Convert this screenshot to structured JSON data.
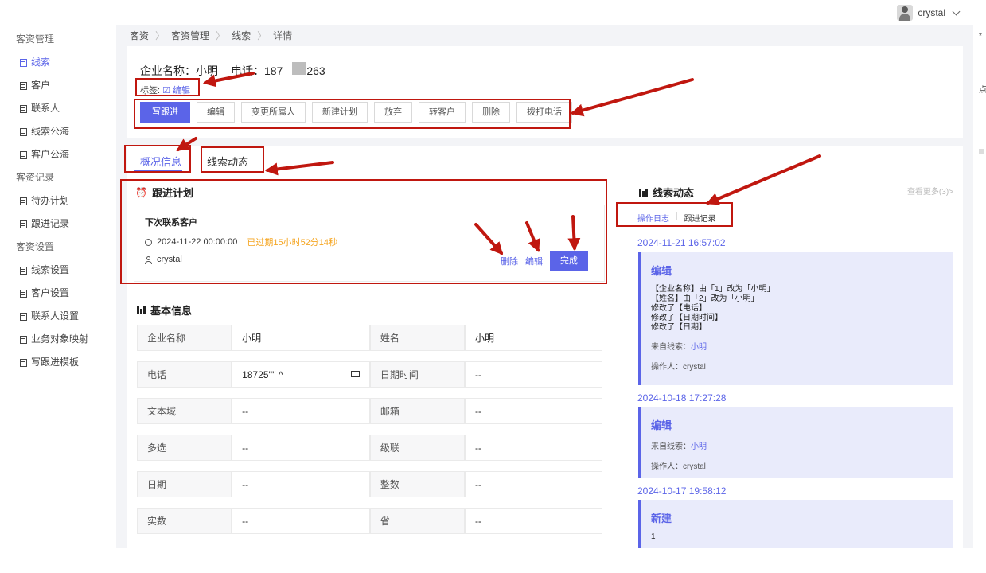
{
  "user": {
    "name": "crystal"
  },
  "sidebar": {
    "groups": [
      {
        "title": "客资管理",
        "items": [
          {
            "label": "线索",
            "active": true
          },
          {
            "label": "客户"
          },
          {
            "label": "联系人"
          },
          {
            "label": "线索公海"
          },
          {
            "label": "客户公海"
          }
        ]
      },
      {
        "title": "客资记录",
        "items": [
          {
            "label": "待办计划"
          },
          {
            "label": "跟进记录"
          }
        ]
      },
      {
        "title": "客资设置",
        "items": [
          {
            "label": "线索设置"
          },
          {
            "label": "客户设置"
          },
          {
            "label": "联系人设置"
          },
          {
            "label": "业务对象映射"
          },
          {
            "label": "写跟进模板"
          }
        ]
      }
    ]
  },
  "breadcrumb": [
    "客资",
    "客资管理",
    "线索",
    "详情"
  ],
  "header": {
    "company_label": "企业名称：小明",
    "phone_label": "电话：187",
    "phone_tail": "263",
    "tags_label": "标签:",
    "tags_edit": "编辑",
    "buttons": [
      "写跟进",
      "编辑",
      "变更所属人",
      "新建计划",
      "放弃",
      "转客户",
      "删除",
      "拨打电话"
    ]
  },
  "tabs": [
    "概况信息",
    "线索动态"
  ],
  "plan": {
    "title": "跟进计划",
    "next_contact": "下次联系客户",
    "datetime": "2024-11-22 00:00:00",
    "overdue": "已过期15小时52分14秒",
    "owner": "crystal",
    "delete": "删除",
    "edit": "编辑",
    "done": "完成"
  },
  "basic": {
    "title": "基本信息",
    "rows": [
      [
        "企业名称",
        "小明",
        "姓名",
        "小明"
      ],
      [
        "电话",
        "18725'''' ^",
        "日期时间",
        "--"
      ],
      [
        "文本域",
        "--",
        "邮箱",
        "--"
      ],
      [
        "多选",
        "--",
        "级联",
        "--"
      ],
      [
        "日期",
        "--",
        "整数",
        "--"
      ],
      [
        "实数",
        "--",
        "省",
        "--"
      ]
    ]
  },
  "dynamics": {
    "title": "线索动态",
    "more": "查看更多(3)>",
    "subtabs": [
      "操作日志",
      "跟进记录"
    ],
    "entries": [
      {
        "date": "2024-11-21 16:57:02",
        "type": "编辑",
        "lines": [
          "【企业名称】由「1」改为「小明」",
          "【姓名】由「2」改为「小明」",
          "修改了【电话】",
          "修改了【日期时间】",
          "修改了【日期】"
        ],
        "source_label": "来自线索：",
        "source": "小明",
        "operator": "操作人：crystal"
      },
      {
        "date": "2024-10-18 17:27:28",
        "type": "编辑",
        "lines": [],
        "source_label": "来自线索：",
        "source": "小明",
        "operator": "操作人：crystal"
      },
      {
        "date": "2024-10-17 19:58:12",
        "type": "新建",
        "lines": [
          "1"
        ],
        "source_label": "",
        "source": "",
        "operator": ""
      }
    ]
  },
  "right_strip": [
    "*",
    "点"
  ]
}
